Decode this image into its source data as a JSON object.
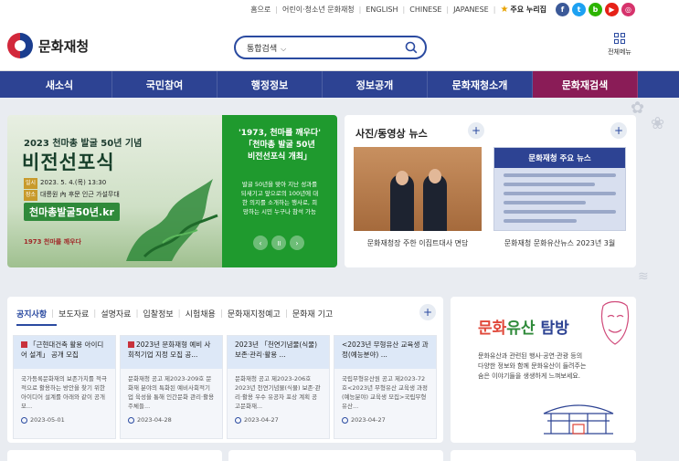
{
  "util": {
    "links": [
      "홈으로",
      "어린이·청소년 문화재청",
      "ENGLISH",
      "CHINESE",
      "JAPANESE"
    ],
    "favorite": "주요 누리집",
    "social": [
      {
        "name": "facebook-icon",
        "glyph": "f",
        "color": "#3b5998"
      },
      {
        "name": "twitter-icon",
        "glyph": "t",
        "color": "#1da1f2"
      },
      {
        "name": "blog-icon",
        "glyph": "b",
        "color": "#2db400"
      },
      {
        "name": "youtube-icon",
        "glyph": "▶",
        "color": "#e62117"
      },
      {
        "name": "instagram-icon",
        "glyph": "◎",
        "color": "#d6336c"
      }
    ]
  },
  "header": {
    "logo_text": "문화재청",
    "search_select": "통합검색",
    "allmenu_label": "전체메뉴"
  },
  "nav": {
    "tabs": [
      "새소식",
      "국민참여",
      "행정정보",
      "정보공개",
      "문화재청소개",
      "문화재검색"
    ],
    "active_index": 5
  },
  "hero": {
    "title1": "2023 천마총 발굴 50년 기념",
    "title2": "비전선포식",
    "date_tag": "일시",
    "date": "2023. 5. 4.(목) 13:30",
    "place_tag": "장소",
    "place": "대릉원 內 후문 인근 가설무대",
    "badge": "천마총발굴50년.kr",
    "logo": "1973 천마를 깨우다",
    "right_title": "'1973, 천마를 깨우다'\n「천마총 발굴 50년\n비전선포식 개최」",
    "right_body": "발굴 50년을 맞아 지난 성과를\n되새기고 앞으로의 100년에 대\n한 의지를 소개하는 행사로, 희\n망하는 시민 누구나 참석 가능"
  },
  "photo_news": {
    "title": "사진/동영상 뉴스",
    "poster_title": "문화재청 주요 뉴스",
    "captions": [
      "문화재청장 주한 이집트대사 면담",
      "문화재청 문화유산뉴스 2023년 3월"
    ]
  },
  "board": {
    "tabs": [
      "공지사항",
      "보도자료",
      "설명자료",
      "입찰정보",
      "시험채용",
      "문화재지정예고",
      "문화재 기고"
    ],
    "cards": [
      {
        "title": "「근현대건축 활용 아이디어 설계」 공개 모집",
        "body": "국가등록문화재의 보존가치를 적극적으로 활용하는 방안을 찾기 위한 아이디어 설계를 아래와 같이 공개 모...",
        "date": "2023-05-01",
        "pin": true
      },
      {
        "title": "2023년 문화재형 예비 사회적기업 지정 모집 공...",
        "body": "문화재청 공고 제2023-209호 문화재 분야의 특화된 예비사회적기업 육성을 통해 인간문화 관리·활용 주체들...",
        "date": "2023-04-28",
        "pin": true
      },
      {
        "title": "2023년 「천연기념물(식물) 보존·관리·활용 ...",
        "body": "문화재청 공고 제2023-206호2023년 천연기념물(식물) 보존·관리·활용 우수 유공자 포상 계획 공고문화재...",
        "date": "2023-04-27",
        "pin": false
      },
      {
        "title": "<2023년 무형유산 교육생 과정(예능분야) ...",
        "body": "국립무형유산원 공고 제2023-72호<2023년 무형유산 교육생 과정(예능분야) 교육생 모집>국립무형유산...",
        "date": "2023-04-27",
        "pin": false
      }
    ]
  },
  "promo": {
    "title_parts": [
      "문화",
      "유산",
      " 탐방"
    ],
    "desc": "문화유산과 관련된 행사·공연·관광 등의\n다양한 정보와 함께 문화유산이 들려주는\n숨은 이야기들을 생생하게 느껴보세요."
  }
}
